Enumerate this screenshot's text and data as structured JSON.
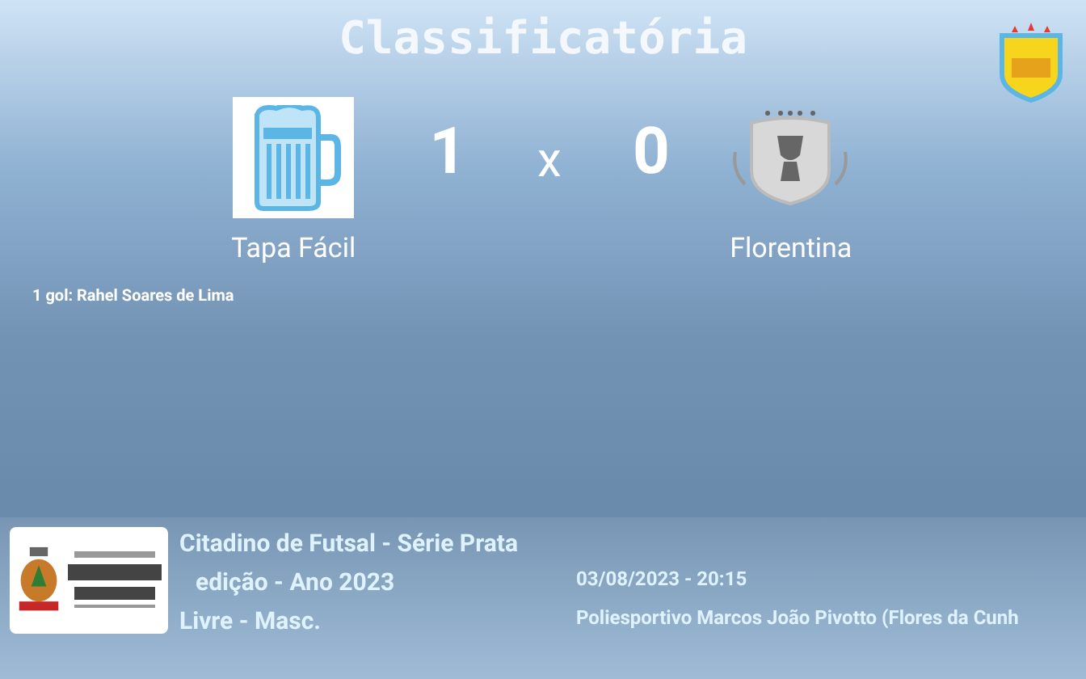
{
  "title": "Classificatória",
  "match": {
    "home": {
      "name": "Tapa Fácil",
      "score": "1"
    },
    "separator": "x",
    "away": {
      "name": "Florentina",
      "score": "0"
    }
  },
  "scorers": [
    "1 gol: Rahel Soares de Lima"
  ],
  "footer": {
    "competition": "Citadino de Futsal - Série Prata",
    "edition": "edição - Ano 2023",
    "category": "Livre - Masc.",
    "datetime": "03/08/2023 - 20:15",
    "venue": "Poliesportivo Marcos João Pivotto (Flores da Cunh"
  }
}
